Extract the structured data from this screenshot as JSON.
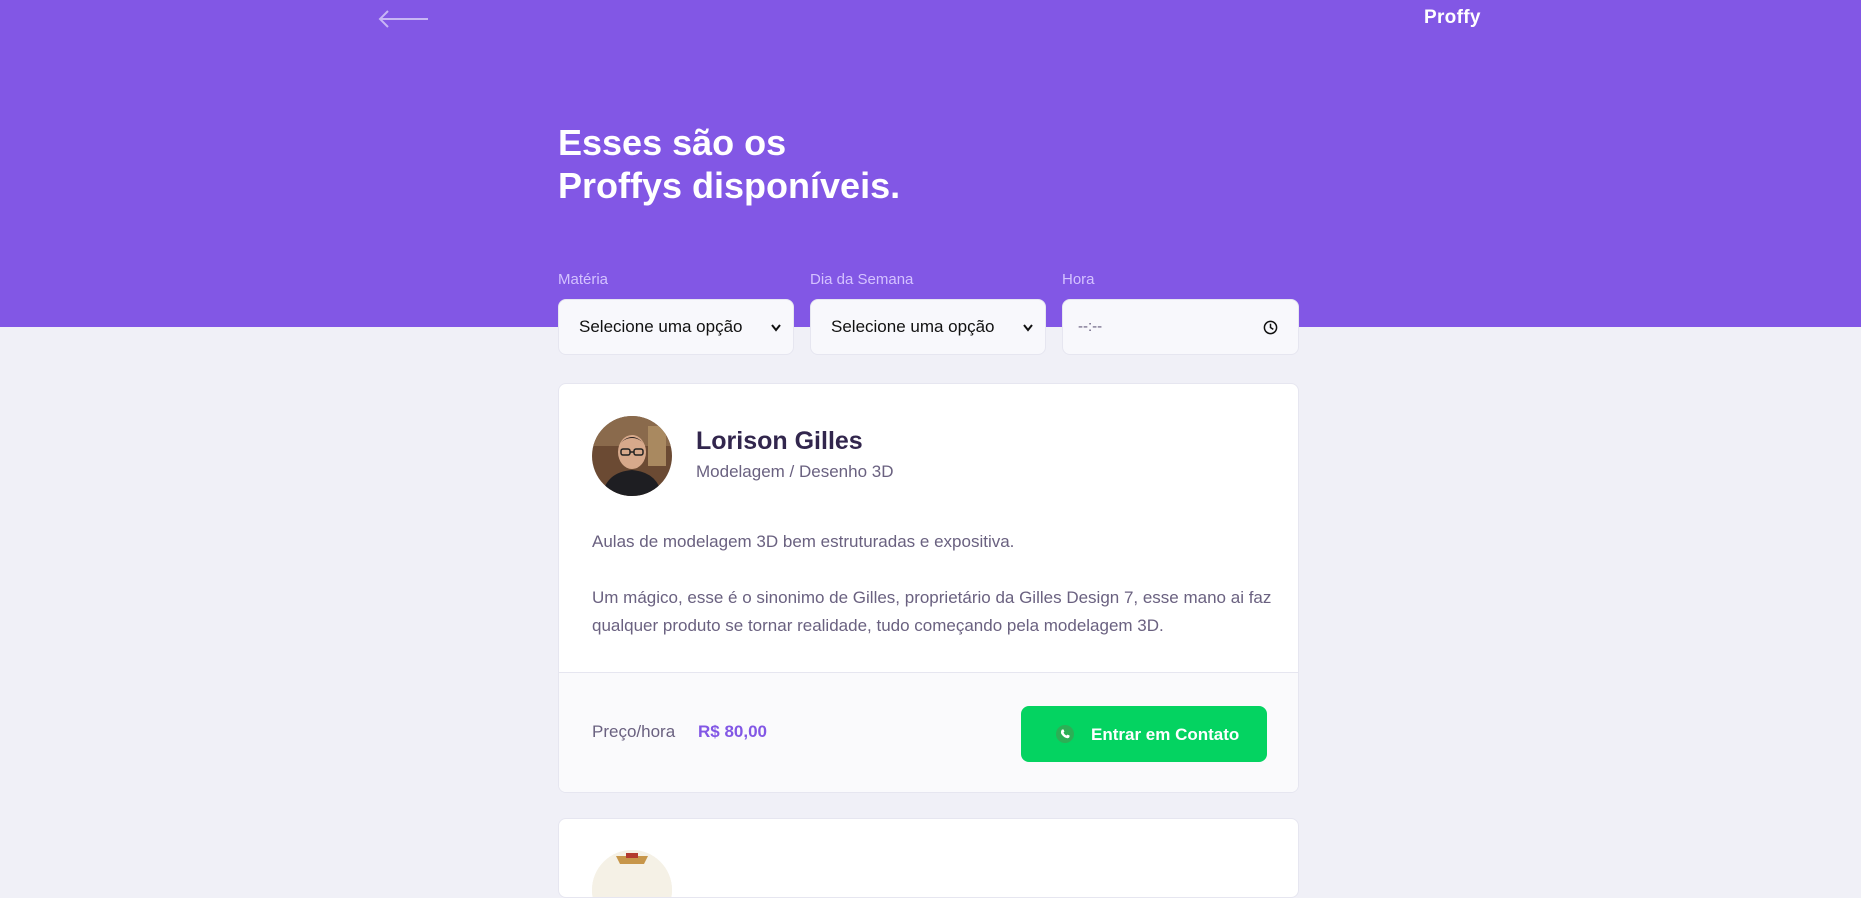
{
  "header": {
    "logo": "Proffy",
    "title_line1": "Esses são os",
    "title_line2": "Proffys disponíveis."
  },
  "filters": {
    "subject_label": "Matéria",
    "subject_value": "Selecione uma opção",
    "weekday_label": "Dia da Semana",
    "weekday_value": "Selecione uma opção",
    "time_label": "Hora",
    "time_value": "--:--"
  },
  "teachers": [
    {
      "name": "Lorison Gilles",
      "subject": "Modelagem / Desenho 3D",
      "bio_p1": "Aulas de modelagem 3D bem estruturadas e expositiva.",
      "bio_p2": "Um mágico, esse é o sinonimo de Gilles, proprietário da Gilles Design 7, esse mano ai faz qualquer produto se tornar realidade, tudo começando pela modelagem 3D.",
      "price_label": "Preço/hora",
      "price": "R$ 80,00",
      "contact_label": "Entrar em Contato"
    }
  ],
  "colors": {
    "primary": "#8257E5",
    "background": "#F0F0F7",
    "secondary": "#04D361",
    "title_text": "#32264D",
    "body_text": "#6A6180"
  },
  "icons": {
    "back": "arrow-left-icon",
    "time": "clock-icon",
    "contact": "whatsapp-icon"
  }
}
